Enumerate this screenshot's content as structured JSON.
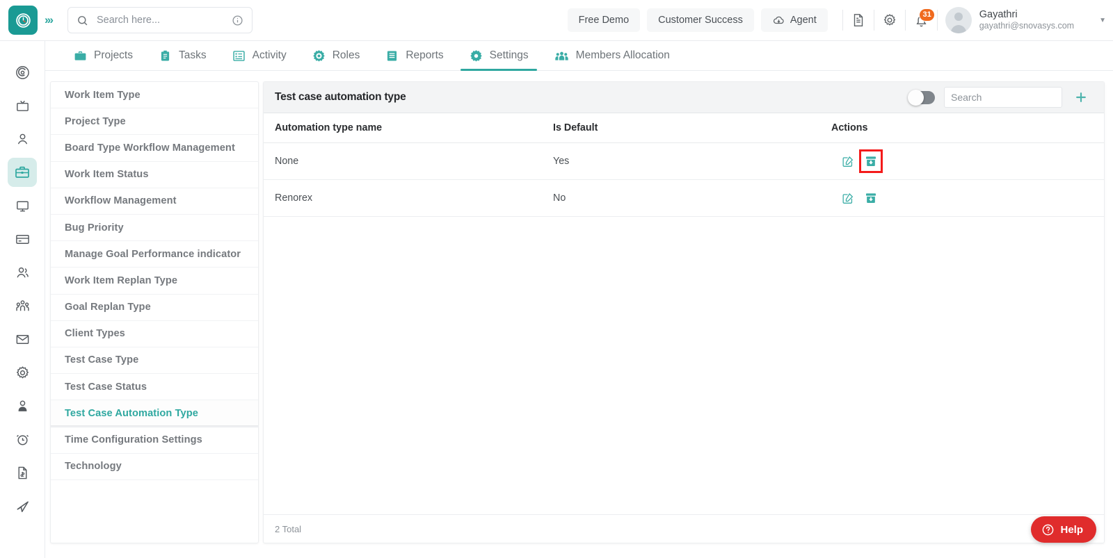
{
  "topbar": {
    "logo_icon": "clock-logo-icon",
    "expand_icon": "chevrons-right-icon",
    "search": {
      "placeholder": "Search here...",
      "value": "",
      "info_icon": "info-circle-icon",
      "search_icon": "search-icon"
    },
    "buttons": [
      {
        "label": "Free Demo",
        "name": "free-demo-button",
        "icon": ""
      },
      {
        "label": "Customer Success",
        "name": "customer-success-button",
        "icon": ""
      },
      {
        "label": "Agent",
        "name": "agent-button",
        "icon": "cloud-download-icon"
      }
    ],
    "doc_icon": "document-icon",
    "settings_icon": "gear-icon",
    "bell_icon": "bell-icon",
    "notification_count": "31",
    "user": {
      "name": "Gayathri",
      "email": "gayathri@snovasys.com",
      "avatar_icon": "avatar-icon",
      "caret_icon": "chevron-down-icon"
    }
  },
  "nav": {
    "tabs": [
      {
        "label": "Projects",
        "icon": "briefcase-icon",
        "active": false
      },
      {
        "label": "Tasks",
        "icon": "clipboard-icon",
        "active": false
      },
      {
        "label": "Activity",
        "icon": "list-box-icon",
        "active": false
      },
      {
        "label": "Roles",
        "icon": "target-gear-icon",
        "active": false
      },
      {
        "label": "Reports",
        "icon": "report-lines-icon",
        "active": false
      },
      {
        "label": "Settings",
        "icon": "gear-icon",
        "active": true
      },
      {
        "label": "Members Allocation",
        "icon": "people-group-icon",
        "active": false
      }
    ]
  },
  "rail": {
    "items": [
      {
        "icon": "target-icon",
        "active": false
      },
      {
        "icon": "tv-icon",
        "active": false
      },
      {
        "icon": "person-icon",
        "active": false
      },
      {
        "icon": "briefcase-icon",
        "active": true
      },
      {
        "icon": "monitor-icon",
        "active": false
      },
      {
        "icon": "credit-card-icon",
        "active": false
      },
      {
        "icon": "users-icon",
        "active": false
      },
      {
        "icon": "group-people-icon",
        "active": false
      },
      {
        "icon": "mail-icon",
        "active": false
      },
      {
        "icon": "gear-icon",
        "active": false
      },
      {
        "icon": "user-badge-icon",
        "active": false
      },
      {
        "icon": "alarm-clock-icon",
        "active": false
      },
      {
        "icon": "invoice-icon",
        "active": false
      },
      {
        "icon": "send-icon",
        "active": false
      }
    ]
  },
  "sidemenu": {
    "items": [
      {
        "label": "Work Item Type",
        "active": false
      },
      {
        "label": "Project Type",
        "active": false
      },
      {
        "label": "Board Type Workflow Management",
        "active": false
      },
      {
        "label": "Work Item Status",
        "active": false
      },
      {
        "label": "Workflow Management",
        "active": false
      },
      {
        "label": "Bug Priority",
        "active": false
      },
      {
        "label": "Manage Goal Performance indicator",
        "active": false
      },
      {
        "label": "Work Item Replan Type",
        "active": false
      },
      {
        "label": "Goal Replan Type",
        "active": false
      },
      {
        "label": "Client Types",
        "active": false
      },
      {
        "label": "Test Case Type",
        "active": false
      },
      {
        "label": "Test Case Status",
        "active": false
      },
      {
        "label": "Test Case Automation Type",
        "active": true
      },
      {
        "label": "Time Configuration Settings",
        "active": false
      },
      {
        "label": "Technology",
        "active": false
      }
    ]
  },
  "panel": {
    "title": "Test case automation type",
    "toggle_on": false,
    "search": {
      "placeholder": "Search",
      "value": ""
    },
    "add_icon": "plus-icon",
    "columns": [
      "Automation type name",
      "Is Default",
      "Actions"
    ],
    "rows": [
      {
        "name": "None",
        "is_default": "Yes",
        "edit_icon": "edit-pencil-icon",
        "archive_icon": "archive-down-icon",
        "highlighted": true
      },
      {
        "name": "Renorex",
        "is_default": "No",
        "edit_icon": "edit-pencil-icon",
        "archive_icon": "archive-down-icon",
        "highlighted": false
      }
    ],
    "total": "2 Total"
  },
  "help": {
    "label": "Help",
    "icon": "question-circle-icon"
  },
  "colors": {
    "teal": "#2fa8a0",
    "teal_icon": "#3aada6",
    "logo_bg": "#1a9a94",
    "badge_orange": "#f06a1e",
    "help_red": "#e02c2c",
    "highlight_red": "#f41b1b",
    "panel_head_bg": "#f3f4f5"
  }
}
